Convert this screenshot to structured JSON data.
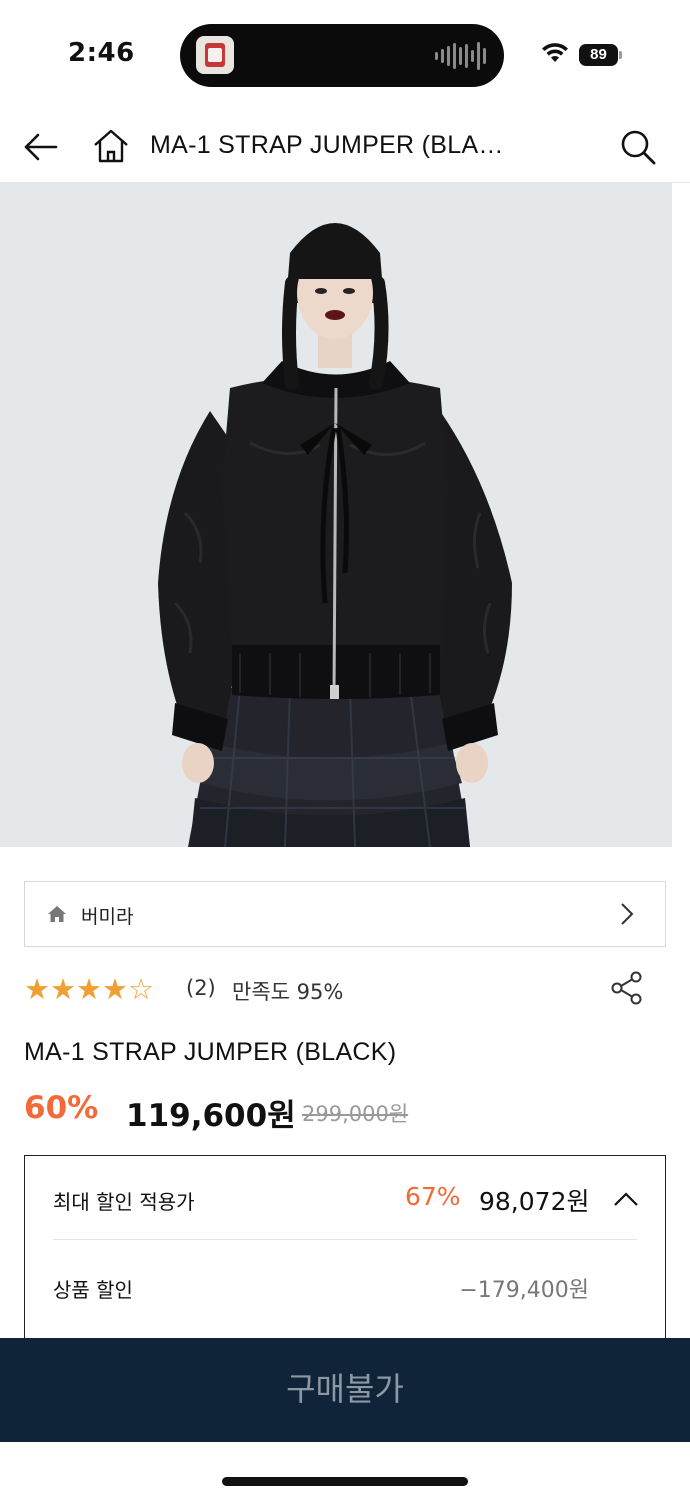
{
  "status_bar": {
    "time": "2:46",
    "battery": "89"
  },
  "header": {
    "title": "MA-1 STRAP JUMPER (BLA…",
    "back_icon": "arrow-left-icon",
    "home_icon": "home-icon",
    "search_icon": "search-icon"
  },
  "product_image": {
    "description_icon": "product-photo",
    "background_color": "#e3e7ea"
  },
  "brand": {
    "name": "버미라",
    "icon": "home-icon"
  },
  "rating": {
    "stars_filled": 4,
    "stars_total": 5,
    "review_count": "(2)",
    "satisfaction": "만족도 95%"
  },
  "product": {
    "title": "MA-1 STRAP JUMPER (BLACK)",
    "discount_rate": "60%",
    "sale_price": "119,600원",
    "original_price": "299,000원"
  },
  "discount_box": {
    "max_label": "최대 할인 적용가",
    "max_rate": "67%",
    "max_price": "98,072원",
    "product_discount_label": "상품 할인",
    "product_discount_value": "−179,400원"
  },
  "buy_button": {
    "label": "구매불가"
  },
  "colors": {
    "accent": "#f26a38",
    "star": "#f0a033",
    "buy_bar": "#0f2439"
  }
}
